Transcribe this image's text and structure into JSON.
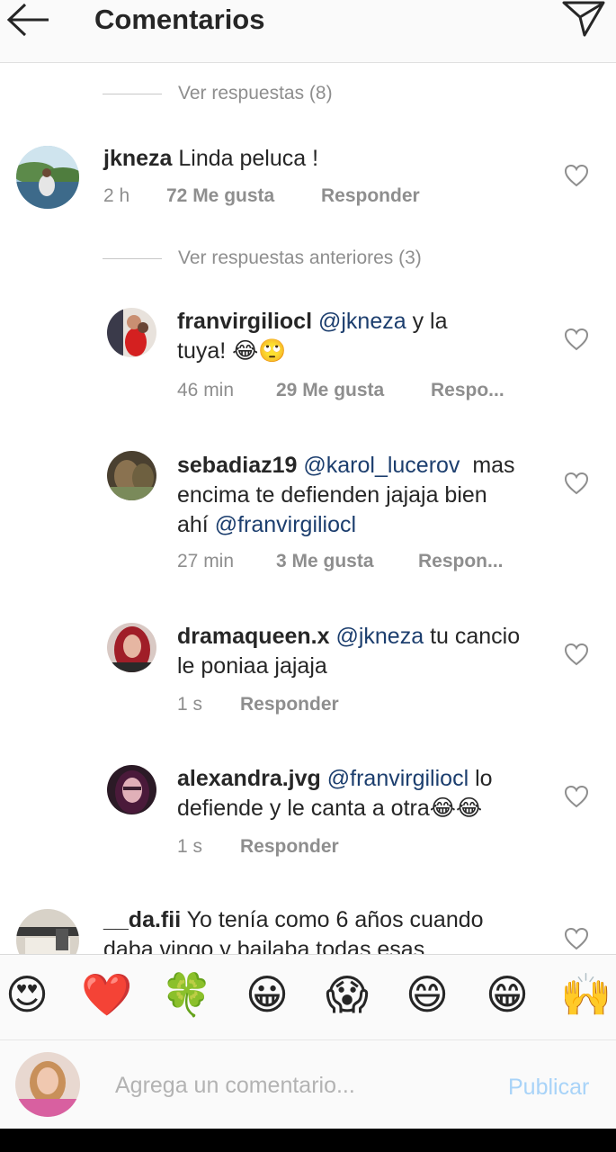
{
  "header": {
    "title": "Comentarios",
    "back_icon": "arrow-left-icon",
    "send_icon": "paper-plane-icon"
  },
  "view_replies_top": "Ver respuestas (8)",
  "view_replies_previous": "Ver respuestas anteriores (3)",
  "comments": [
    {
      "user": "jkneza",
      "text": " Linda peluca !",
      "time": "2 h",
      "likes": "72 Me gusta",
      "reply": "Responder"
    },
    {
      "user": "franvirgiliocl",
      "mention": "@jkneza",
      "text_line1": " y la",
      "text_line2": "tuya! 😂🙄",
      "time": "46 min",
      "likes": "29 Me gusta",
      "reply": "Respo..."
    },
    {
      "user": "sebadiaz19",
      "mention": "@karol_lucerov",
      "text_line1": "  mas",
      "text_line2": "encima te defienden jajaja bien",
      "text_line3_prefix": "ahí ",
      "mention2": "@franvirgiliocl",
      "time": "27 min",
      "likes": "3 Me gusta",
      "reply": "Respon..."
    },
    {
      "user": "dramaqueen.x",
      "mention": "@jkneza",
      "text_line1": " tu cancio",
      "text_line2": "le poniaa jajaja",
      "time": "1 s",
      "reply": "Responder"
    },
    {
      "user": "alexandra.jvg",
      "mention": "@franvirgiliocl",
      "text_line1": " lo",
      "text_line2": "defiende y le canta a otra😂😂",
      "time": "1 s",
      "reply": "Responder"
    },
    {
      "user": "__da.fii",
      "text_line1": " Yo tenía como 6 años cuando",
      "text_line2": "daba vingo y bailaba todas esas"
    }
  ],
  "emojis": [
    "😍",
    "❤️",
    "🍀",
    "😀",
    "😱",
    "😄",
    "😁",
    "🙌"
  ],
  "input": {
    "placeholder": "Agrega un comentario...",
    "publish": "Publicar"
  },
  "colors": {
    "mention": "#1c3e6e",
    "publish_disabled": "#a8d3f8",
    "meta_gray": "#8e8e8e"
  }
}
